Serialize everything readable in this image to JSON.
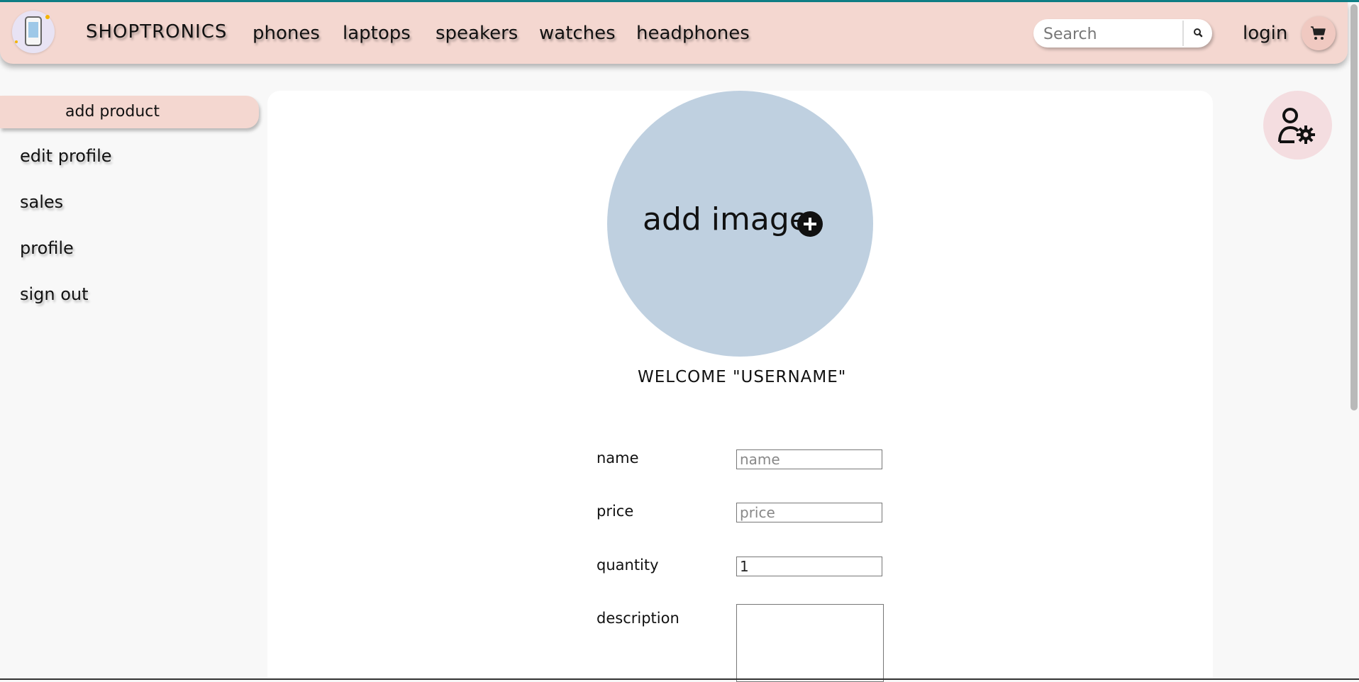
{
  "navbar": {
    "brand": "SHOPTRONICS",
    "links": [
      "phones",
      "laptops",
      "speakers",
      "watches",
      "headphones"
    ],
    "search": {
      "placeholder": "Search",
      "value": ""
    },
    "login_label": "login"
  },
  "sidebar": {
    "items": [
      "add product",
      "edit profile",
      "sales",
      "profile",
      "sign out"
    ],
    "active_index": 0
  },
  "main": {
    "add_image_label": "add image",
    "welcome_text": "WELCOME \"USERNAME\"",
    "form": {
      "name_label": "name",
      "name_placeholder": "name",
      "price_label": "price",
      "price_placeholder": "price",
      "quantity_label": "quantity",
      "quantity_value": "1",
      "description_label": "description"
    }
  },
  "colors": {
    "navbar_bg": "#f4d7d0",
    "accent_teal": "#0f7f86",
    "image_circle": "#bfd0e0",
    "settings_bg": "#f4dde0"
  },
  "icons": [
    "logo-phone-icon",
    "search-icon",
    "cart-icon",
    "plus-circle-icon",
    "user-settings-icon"
  ]
}
